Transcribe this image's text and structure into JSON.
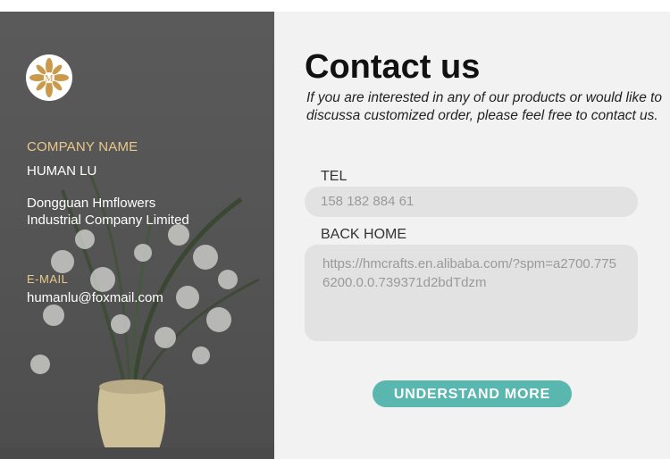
{
  "contact": {
    "company_label": "COMPANY NAME",
    "contact_name": "HUMAN LU",
    "company_line1": "Dongguan Hmflowers",
    "company_line2": "Industrial Company Limited",
    "email_label": "E-MAIL",
    "email": "humanlu@foxmail.com"
  },
  "form": {
    "title": "Contact us",
    "intro": "If you are interested in any of our products or would like to discussa customized order,  please feel free to contact us.",
    "tel_label": "TEL",
    "tel_value": "158 182 884 61",
    "home_label": "BACK HOME",
    "home_value": "https://hmcrafts.en.alibaba.com/?spm=a2700.7756200.0.0.739371d2bdTdzm",
    "cta_label": "UNDERSTAND MORE"
  },
  "colors": {
    "accent_label": "#e9c98a",
    "button": "#59b7b0",
    "panel_dark": "#555555",
    "panel_light": "#f2f2f2"
  },
  "icons": {
    "logo": "hm-flower-logo"
  }
}
